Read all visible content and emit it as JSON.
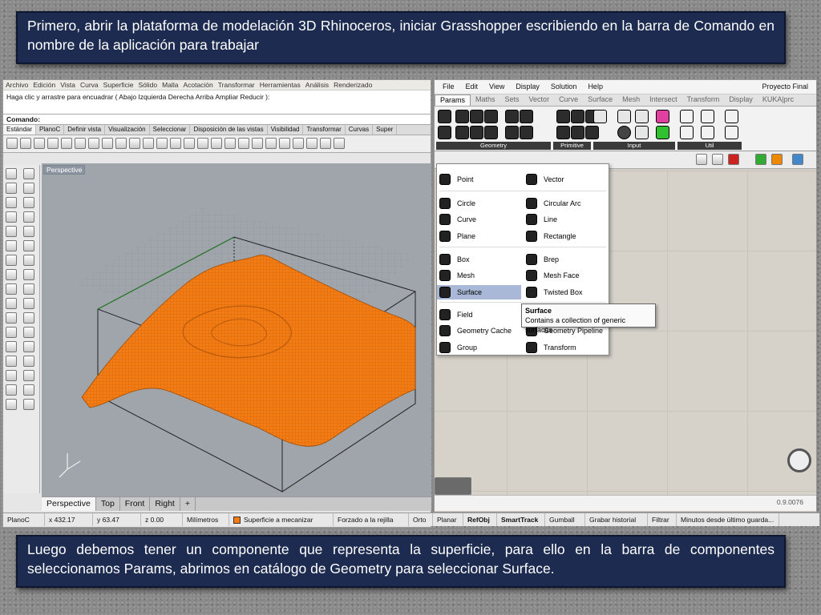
{
  "captions": {
    "top": "Primero, abrir la plataforma de modelación 3D Rhinoceros, iniciar Grasshopper escribiendo en la barra de Comando en nombre de la aplicación para trabajar",
    "bottom": "Luego debemos tener un componente que representa la superficie, para ello en la barra de componentes seleccionamos Params, abrimos en catálogo de Geometry para seleccionar Surface."
  },
  "rhino": {
    "menu": [
      "Archivo",
      "Edición",
      "Vista",
      "Curva",
      "Superficie",
      "Sólido",
      "Malla",
      "Acotación",
      "Transformar",
      "Herramientas",
      "Análisis",
      "Renderizado"
    ],
    "command_history": "Haga clic y arrastre para encuadrar ( Abajo  Izquierda  Derecha  Arriba  Ampliar  Reducir ):",
    "command_label": "Comando:",
    "tabs": [
      "Estándar",
      "PlanoC",
      "Definir vista",
      "Visualización",
      "Seleccionar",
      "Disposición de las vistas",
      "Visibilidad",
      "Transformar",
      "Curvas",
      "Super"
    ],
    "viewport_label": "Perspective",
    "viewport_tabs": [
      "Perspective",
      "Top",
      "Front",
      "Right",
      "+"
    ],
    "status": {
      "cplane": "PlanoC",
      "x": "x 432.17",
      "y": "y 63.47",
      "z": "z 0.00",
      "units": "Milímetros",
      "layer": "Superficie a mecanizar",
      "snap": "Forzado a la rejilla",
      "ortho": "Orto",
      "planar": "Planar",
      "refobj": "RefObj",
      "smarttrack": "SmartTrack",
      "gumball": "Gumball",
      "history": "Grabar historial",
      "filter": "Filtrar",
      "minutes": "Minutos desde último guarda..."
    },
    "colors": {
      "surface": "#f57c14",
      "layer_swatch": "#f57c14"
    }
  },
  "grasshopper": {
    "menu": [
      "File",
      "Edit",
      "View",
      "Display",
      "Solution",
      "Help"
    ],
    "doc_title": "Proyecto Final",
    "tabs": [
      "Params",
      "Maths",
      "Sets",
      "Vector",
      "Curve",
      "Surface",
      "Mesh",
      "Intersect",
      "Transform",
      "Display",
      "KUKA|prc"
    ],
    "panels": [
      "Geometry",
      "Primitive",
      "Input",
      "Util"
    ],
    "zoom": "0.9.0076",
    "dropdown": {
      "items": [
        [
          "Point",
          "Vector"
        ],
        [
          "Circle",
          "Circular Arc"
        ],
        [
          "Curve",
          "Line"
        ],
        [
          "Plane",
          "Rectangle"
        ],
        [
          "Box",
          "Brep"
        ],
        [
          "Mesh",
          "Mesh Face"
        ],
        [
          "Surface",
          "Twisted Box"
        ],
        [
          "Field",
          "Geometry Pipeline"
        ],
        [
          "Geometry Cache",
          "Geometry Pipeline"
        ],
        [
          "Group",
          "Transform"
        ]
      ]
    },
    "tooltip": {
      "title": "Surface",
      "text": "Contains a collection of generic surfaces"
    }
  }
}
